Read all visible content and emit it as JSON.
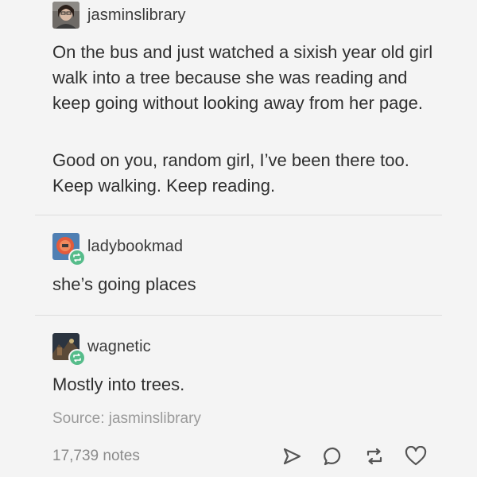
{
  "post": {
    "author": {
      "username": "jasminslibrary",
      "avatar_icon": "user-avatar-icon"
    },
    "body_paragraphs": [
      "On the bus and just watched a sixish year old girl walk into a tree because she was reading and keep going without looking away from her page.",
      "Good on you, random girl, I’ve been there too. Keep walking. Keep reading."
    ]
  },
  "reblogs": [
    {
      "username": "ladybookmad",
      "text": "she’s going places",
      "badge_icon": "reblog-icon"
    },
    {
      "username": "wagnetic",
      "text": "Mostly into trees.",
      "badge_icon": "reblog-icon"
    }
  ],
  "source": "Source: jasminslibrary",
  "footer": {
    "notes": "17,739 notes",
    "actions": [
      "share-icon",
      "reply-icon",
      "reblog-icon",
      "like-icon"
    ]
  },
  "colors": {
    "background": "#f4f4f4",
    "text": "#2f2f2f",
    "muted": "#9a9a9a",
    "reblog_green": "#56bc8a",
    "divider": "#dcdcdc"
  }
}
